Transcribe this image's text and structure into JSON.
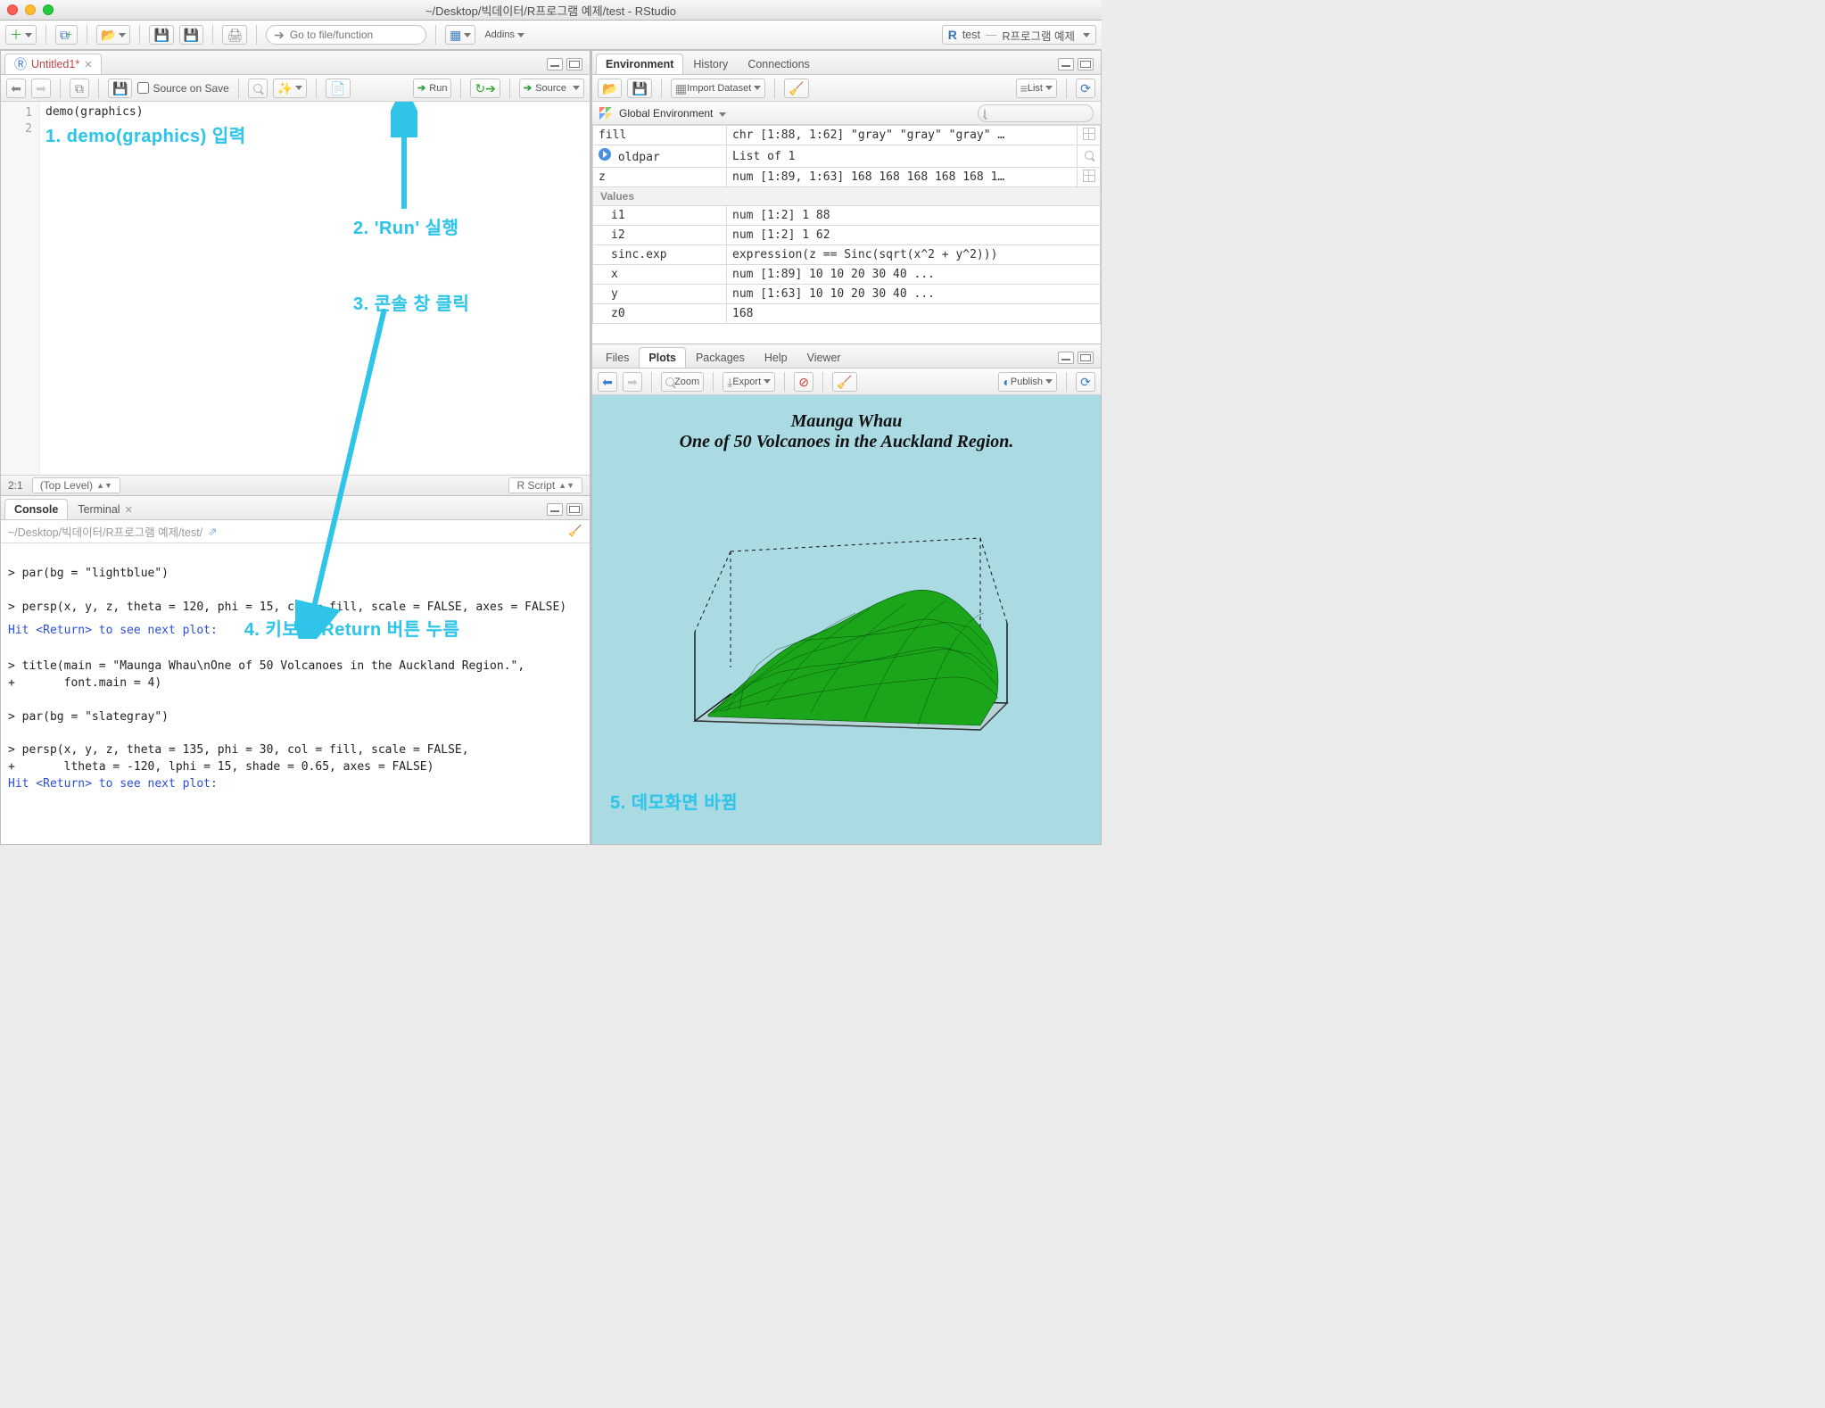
{
  "window": {
    "title": "~/Desktop/빅데이터/R프로그램 예제/test - RStudio"
  },
  "main_toolbar": {
    "goto_placeholder": "Go to file/function",
    "addins_label": "Addins",
    "project": {
      "name": "test",
      "parent": "R프로그램 예제"
    }
  },
  "source": {
    "tab_label": "Untitled1*",
    "source_on_save": "Source on Save",
    "run_label": "Run",
    "source_label": "Source",
    "code_line_1": "demo(graphics)",
    "status_pos": "2:1",
    "status_scope": "(Top Level)",
    "status_lang": "R Script"
  },
  "annotations": {
    "a1": "1. demo(graphics) 입력",
    "a2": "2. 'Run' 실행",
    "a3": "3. 콘솔 창 클릭",
    "a4": "4. 키보드 Return 버튼 누름",
    "a5": "5. 데모화면 바뀜"
  },
  "console": {
    "tab_console": "Console",
    "tab_terminal": "Terminal",
    "wd": "~/Desktop/빅데이터/R프로그램 예제/test/",
    "line1": "> par(bg = \"lightblue\")",
    "line2": "",
    "line3": "> persp(x, y, z, theta = 120, phi = 15, col = fill, scale = FALSE, axes = FALSE)",
    "line4": "Hit <Return> to see next plot:",
    "line5": "",
    "line6": "> title(main = \"Maunga Whau\\nOne of 50 Volcanoes in the Auckland Region.\",",
    "line7": "+       font.main = 4)",
    "line8": "",
    "line9": "> par(bg = \"slategray\")",
    "line10": "",
    "line11": "> persp(x, y, z, theta = 135, phi = 30, col = fill, scale = FALSE,",
    "line12": "+       ltheta = -120, lphi = 15, shade = 0.65, axes = FALSE)",
    "line13": "Hit <Return> to see next plot:"
  },
  "environment": {
    "tabs": {
      "env": "Environment",
      "hist": "History",
      "conn": "Connections"
    },
    "import_label": "Import Dataset",
    "view_label": "List",
    "scope": "Global Environment",
    "rows": [
      {
        "name": "fill",
        "value": "chr [1:88, 1:62] \"gray\" \"gray\" \"gray\" …",
        "icon": "grid"
      },
      {
        "name": "oldpar",
        "value": "List of 1",
        "lead": "play",
        "icon": "mag"
      },
      {
        "name": "z",
        "value": "num [1:89, 1:63] 168 168 168 168 168 1…",
        "icon": "grid"
      }
    ],
    "values_label": "Values",
    "values": [
      {
        "name": "i1",
        "value": "num [1:2] 1 88"
      },
      {
        "name": "i2",
        "value": "num [1:2] 1 62"
      },
      {
        "name": "sinc.exp",
        "value": "expression(z == Sinc(sqrt(x^2 + y^2)))"
      },
      {
        "name": "x",
        "value": "num [1:89] 10 10 20 30 40 ..."
      },
      {
        "name": "y",
        "value": "num [1:63] 10 10 20 30 40 ..."
      },
      {
        "name": "z0",
        "value": "168"
      }
    ]
  },
  "plots": {
    "tabs": {
      "files": "Files",
      "plots": "Plots",
      "packages": "Packages",
      "help": "Help",
      "viewer": "Viewer"
    },
    "zoom": "Zoom",
    "export": "Export",
    "publish": "Publish",
    "title_line1": "Maunga Whau",
    "title_line2": "One of 50 Volcanoes in the Auckland Region."
  },
  "chart_data": {
    "type": "surface",
    "title": "Maunga Whau\nOne of 50 Volcanoes in the Auckland Region.",
    "description": "3D wireframe perspective plot from R demo(graphics): persp(x, y, z, theta=120, phi=15, col=fill, scale=FALSE, axes=FALSE) with background lightblue",
    "x_range": [
      10,
      40
    ],
    "x_n": 89,
    "y_range": [
      10,
      40
    ],
    "y_n": 63,
    "z_peak": 168,
    "theta": 120,
    "phi": 15,
    "col": "green shades (fill matrix)",
    "bg": "lightblue",
    "axes": false,
    "scale": false
  }
}
